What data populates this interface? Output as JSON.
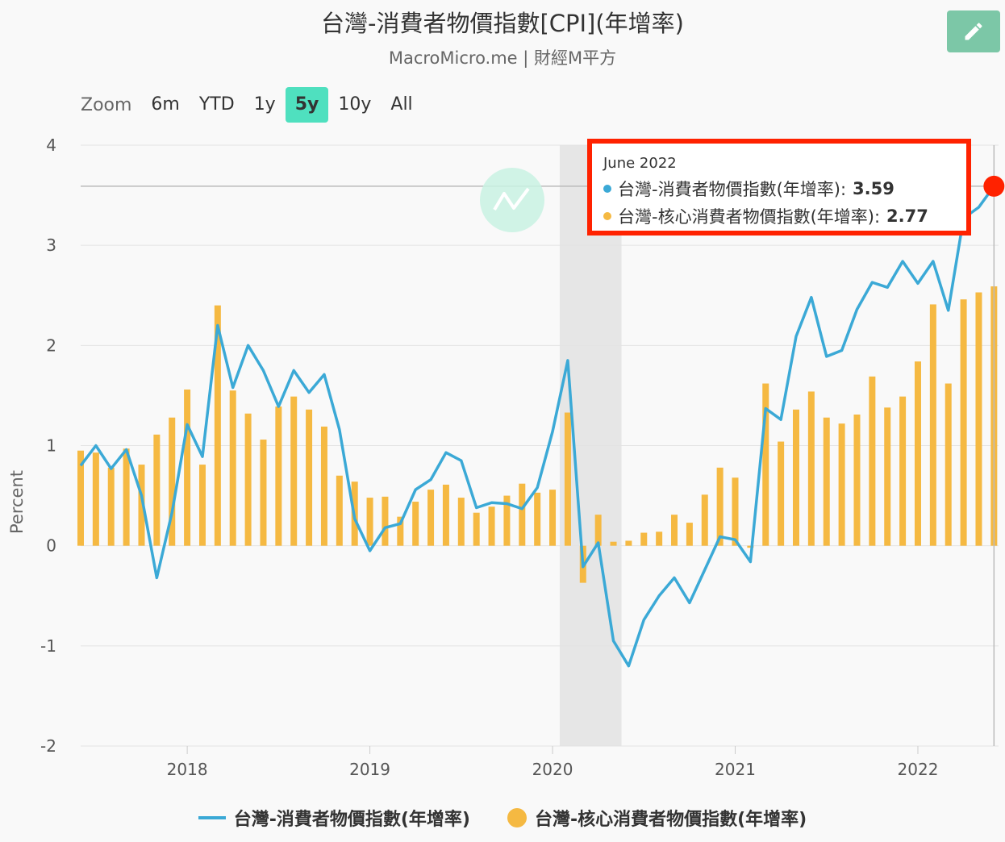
{
  "header": {
    "title": "台灣-消費者物價指數[CPI](年增率)",
    "subtitle": "MacroMicro.me | 財經M平方",
    "edit_icon": "pencil-icon"
  },
  "zoom": {
    "label": "Zoom",
    "options": [
      "6m",
      "YTD",
      "1y",
      "5y",
      "10y",
      "All"
    ],
    "active": "5y"
  },
  "colors": {
    "cpi": "#3ba9d6",
    "core": "#f5b942",
    "marker": "#ff2200",
    "grid": "#e3e3e3",
    "recession": "#e6e6e6"
  },
  "tooltip": {
    "date": "June 2022",
    "rows": [
      {
        "label": "台灣-消費者物價指數(年增率):",
        "value": "3.59"
      },
      {
        "label": "台灣-核心消費者物價指數(年增率):",
        "value": "2.77"
      }
    ]
  },
  "chart_data": {
    "type": "bar+line",
    "ylabel": "Percent",
    "ylim": [
      -2,
      4
    ],
    "yticks": [
      "4",
      "3",
      "2",
      "1",
      "0",
      "-1",
      "-2"
    ],
    "xticks": [
      "2018",
      "2019",
      "2020",
      "2021",
      "2022"
    ],
    "x_start": "2017-06",
    "x_end": "2022-06",
    "shaded_period": [
      "2020-02",
      "2020-05"
    ],
    "series": [
      {
        "name": "台灣-消費者物價指數(年增率)",
        "kind": "line",
        "values": [
          0.8,
          1.0,
          0.77,
          0.96,
          0.5,
          -0.32,
          0.33,
          1.21,
          0.89,
          2.2,
          1.58,
          2.0,
          1.75,
          1.39,
          1.75,
          1.53,
          1.71,
          1.16,
          0.27,
          -0.05,
          0.18,
          0.22,
          0.56,
          0.66,
          0.93,
          0.85,
          0.38,
          0.43,
          0.42,
          0.37,
          0.58,
          1.14,
          1.85,
          -0.21,
          0.03,
          -0.95,
          -1.2,
          -0.74,
          -0.5,
          -0.32,
          -0.57,
          -0.24,
          0.09,
          0.06,
          -0.16,
          1.37,
          1.26,
          2.09,
          2.48,
          1.89,
          1.95,
          2.36,
          2.63,
          2.58,
          2.84,
          2.62,
          2.84,
          2.35,
          3.27,
          3.38,
          3.59
        ]
      },
      {
        "name": "台灣-核心消費者物價指數(年增率)",
        "kind": "bar",
        "values": [
          0.95,
          0.93,
          0.78,
          0.97,
          0.81,
          1.11,
          1.28,
          1.56,
          0.81,
          2.4,
          1.55,
          1.32,
          1.06,
          1.39,
          1.49,
          1.36,
          1.19,
          0.7,
          0.64,
          0.48,
          0.49,
          0.29,
          0.44,
          0.56,
          0.61,
          0.48,
          0.33,
          0.39,
          0.5,
          0.62,
          0.53,
          0.56,
          1.33,
          -0.37,
          0.31,
          0.04,
          0.05,
          0.13,
          0.14,
          0.31,
          0.23,
          0.51,
          0.78,
          0.68,
          -0.02,
          1.62,
          1.04,
          1.36,
          1.54,
          1.28,
          1.22,
          1.31,
          1.69,
          1.38,
          1.49,
          1.84,
          2.41,
          1.62,
          2.46,
          2.53,
          2.59,
          2.77
        ]
      }
    ]
  },
  "legend": {
    "items": [
      "台灣-消費者物價指數(年增率)",
      "台灣-核心消費者物價指數(年增率)"
    ]
  }
}
